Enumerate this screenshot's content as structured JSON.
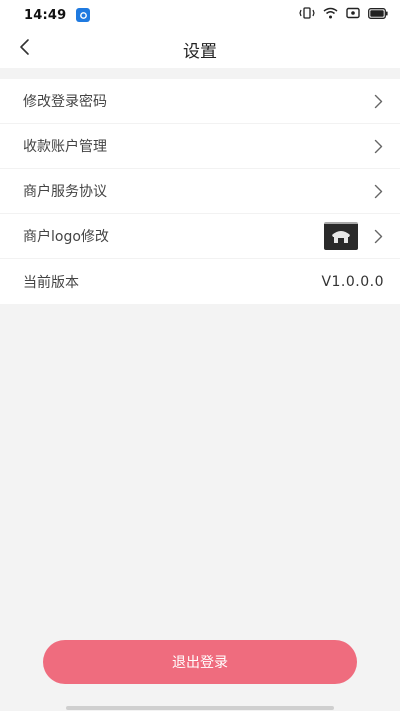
{
  "status_bar": {
    "time": "14:49",
    "icons": [
      "app-notification-icon",
      "vibrate-icon",
      "wifi-icon",
      "screen-record-icon",
      "battery-icon"
    ]
  },
  "header": {
    "title": "设置",
    "back_icon": "chevron-left-icon"
  },
  "settings": {
    "items": [
      {
        "label": "修改登录密码",
        "icon": "chevron-right-icon"
      },
      {
        "label": "收款账户管理",
        "icon": "chevron-right-icon"
      },
      {
        "label": "商户服务协议",
        "icon": "chevron-right-icon"
      },
      {
        "label": "商户logo修改",
        "icon": "chevron-right-icon"
      },
      {
        "label": "当前版本",
        "value": "V1.0.0.0"
      }
    ]
  },
  "logout_button": {
    "label": "退出登录"
  },
  "colors": {
    "accent": "#ef6c7e",
    "background": "#f3f3f3",
    "card": "#ffffff"
  }
}
